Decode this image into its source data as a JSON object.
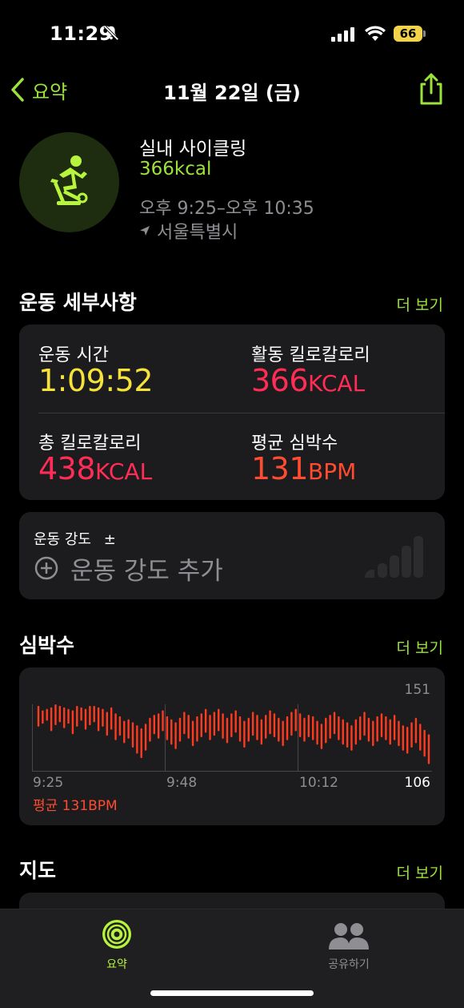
{
  "status": {
    "time": "11:29",
    "battery": "66"
  },
  "nav": {
    "back_label": "요약",
    "title": "11월 22일 (금)"
  },
  "workout": {
    "name": "실내 사이클링",
    "kcal": "366kcal",
    "time_range": "오후 9:25–오후 10:35",
    "location": "서울특별시"
  },
  "details": {
    "title": "운동 세부사항",
    "more": "더 보기",
    "metrics": [
      {
        "label": "운동 시간",
        "value": "1:09:52",
        "unit": "",
        "color": "#f5e33a"
      },
      {
        "label": "활동 킬로칼로리",
        "value": "366",
        "unit": "KCAL",
        "color": "#ff2d55"
      },
      {
        "label": "총 킬로칼로리",
        "value": "438",
        "unit": "KCAL",
        "color": "#ff2d55"
      },
      {
        "label": "평균 심박수",
        "value": "131",
        "unit": "BPM",
        "color": "#ff4b30"
      }
    ]
  },
  "effort": {
    "label": "운동 강도",
    "plusminus": "±",
    "add_label": "운동 강도 추가"
  },
  "heart_rate": {
    "title": "심박수",
    "more": "더 보기",
    "max_label": "151",
    "min_label": "106",
    "x_labels": [
      "9:25",
      "9:48",
      "10:12"
    ],
    "average": "평균 131BPM"
  },
  "chart_data": {
    "type": "bar",
    "x_labels": [
      "9:25",
      "9:48",
      "10:12"
    ],
    "ylim": [
      106,
      151
    ],
    "bar_color": "#ff3b1f",
    "series": [
      {
        "values": [
          [
            136,
            150
          ],
          [
            138,
            147
          ],
          [
            140,
            148
          ],
          [
            133,
            149
          ],
          [
            137,
            151
          ],
          [
            139,
            150
          ],
          [
            135,
            149
          ],
          [
            138,
            148
          ],
          [
            131,
            147
          ],
          [
            136,
            150
          ],
          [
            140,
            149
          ],
          [
            134,
            148
          ],
          [
            137,
            150
          ],
          [
            139,
            150
          ],
          [
            133,
            149
          ],
          [
            136,
            148
          ],
          [
            130,
            146
          ],
          [
            134,
            149
          ],
          [
            127,
            145
          ],
          [
            130,
            143
          ],
          [
            125,
            140
          ],
          [
            128,
            141
          ],
          [
            122,
            139
          ],
          [
            118,
            137
          ],
          [
            115,
            135
          ],
          [
            120,
            138
          ],
          [
            126,
            142
          ],
          [
            131,
            144
          ],
          [
            128,
            145
          ],
          [
            133,
            147
          ],
          [
            127,
            143
          ],
          [
            124,
            141
          ],
          [
            121,
            139
          ],
          [
            126,
            142
          ],
          [
            131,
            146
          ],
          [
            128,
            144
          ],
          [
            123,
            140
          ],
          [
            126,
            143
          ],
          [
            129,
            145
          ],
          [
            132,
            148
          ],
          [
            127,
            144
          ],
          [
            130,
            146
          ],
          [
            133,
            148
          ],
          [
            128,
            145
          ],
          [
            125,
            142
          ],
          [
            129,
            145
          ],
          [
            132,
            147
          ],
          [
            126,
            143
          ],
          [
            122,
            140
          ],
          [
            126,
            142
          ],
          [
            130,
            146
          ],
          [
            127,
            144
          ],
          [
            124,
            141
          ],
          [
            128,
            144
          ],
          [
            131,
            147
          ],
          [
            129,
            145
          ],
          [
            126,
            142
          ],
          [
            123,
            140
          ],
          [
            127,
            143
          ],
          [
            130,
            146
          ],
          [
            133,
            148
          ],
          [
            129,
            145
          ],
          [
            126,
            142
          ],
          [
            129,
            144
          ],
          [
            127,
            143
          ],
          [
            124,
            140
          ],
          [
            121,
            138
          ],
          [
            125,
            142
          ],
          [
            128,
            144
          ],
          [
            131,
            146
          ],
          [
            127,
            143
          ],
          [
            124,
            141
          ],
          [
            122,
            139
          ],
          [
            120,
            137
          ],
          [
            124,
            141
          ],
          [
            127,
            143
          ],
          [
            130,
            146
          ],
          [
            126,
            142
          ],
          [
            123,
            140
          ],
          [
            126,
            143
          ],
          [
            129,
            145
          ],
          [
            127,
            143
          ],
          [
            124,
            141
          ],
          [
            127,
            144
          ],
          [
            123,
            140
          ],
          [
            120,
            137
          ],
          [
            118,
            136
          ],
          [
            122,
            139
          ],
          [
            125,
            142
          ],
          [
            120,
            138
          ],
          [
            116,
            134
          ],
          [
            111,
            131
          ]
        ]
      }
    ]
  },
  "map": {
    "title": "지도",
    "more": "더 보기"
  },
  "tabs": [
    {
      "label": "요약"
    },
    {
      "label": "공유하기"
    }
  ]
}
